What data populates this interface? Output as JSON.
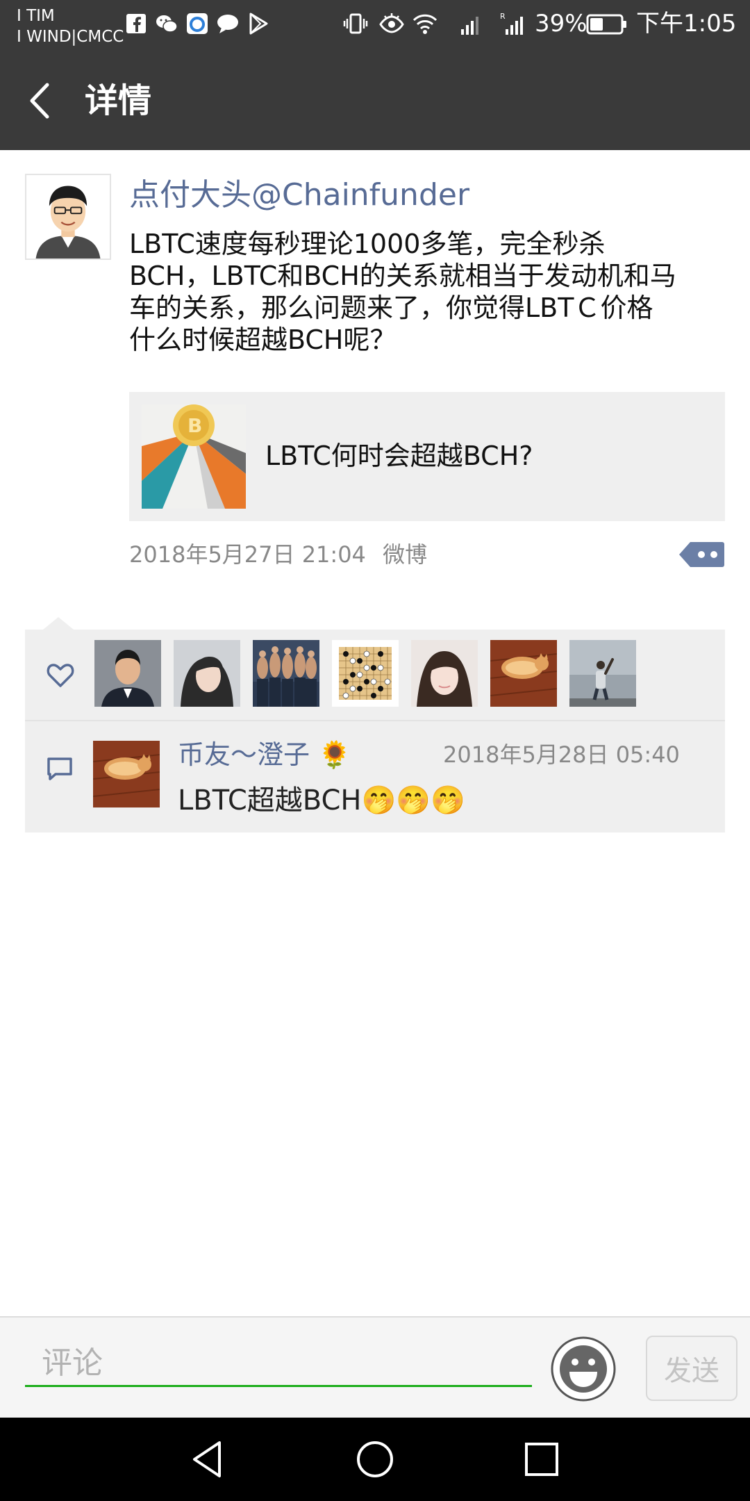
{
  "status_bar": {
    "carrier_line1": "I TIM",
    "carrier_line2": "I WIND|CMCC",
    "battery_percent": "39%",
    "time": "下午1:05",
    "icons": [
      "facebook-icon",
      "wechat-icon",
      "browser-icon",
      "message-icon",
      "play-store-icon",
      "vibrate-icon",
      "eye-icon",
      "wifi-icon",
      "signal-icon",
      "signal-roaming-icon",
      "battery-icon"
    ]
  },
  "header": {
    "title": "详情",
    "back_icon": "back-arrow-icon"
  },
  "post": {
    "author": "点付大头@Chainfunder",
    "text": "LBTC速度每秒理论1000多笔，完全秒杀\nBCH，LBTC和BCH的关系就相当于发动机和马\n车的关系，那么问题来了，你觉得LBTＣ价格\n什么时候超越BCH呢？",
    "link": {
      "title": "LBTC何时会超越BCH?"
    },
    "timestamp": "2018年5月27日 21:04",
    "source": "微博"
  },
  "likes": {
    "icon": "heart-icon",
    "count": 7
  },
  "comments": [
    {
      "author": "币友～澄子 🌻",
      "time": "2018年5月28日 05:40",
      "text": "LBTC超越BCH🤭🤭🤭"
    }
  ],
  "composer": {
    "placeholder": "评论",
    "send_label": "发送",
    "emoji_icon": "smiley-icon"
  },
  "colors": {
    "bar": "#3a3a3a",
    "link_blue": "#576b95",
    "panel_bg": "#efefef",
    "input_underline": "#1aad19"
  }
}
